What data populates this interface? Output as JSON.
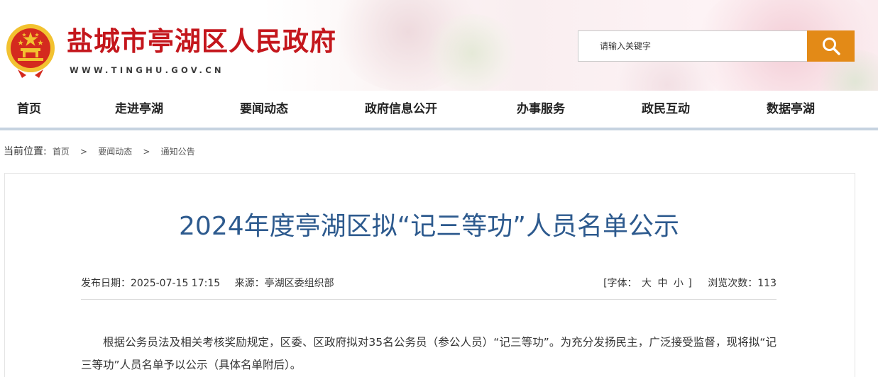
{
  "header": {
    "site_title": "盐城市亭湖区人民政府",
    "site_domain": "WWW.TINGHU.GOV.CN",
    "emblem_icon": "national-emblem-icon",
    "colors": {
      "title_red": "#c4161c",
      "search_orange": "#e38a17",
      "emblem_red": "#d42a1e",
      "emblem_gold": "#f2c230"
    }
  },
  "search": {
    "placeholder": "请输入关键字",
    "button_icon": "search-icon"
  },
  "nav": {
    "items": [
      {
        "label": "首页"
      },
      {
        "label": "走进亭湖"
      },
      {
        "label": "要闻动态"
      },
      {
        "label": "政府信息公开"
      },
      {
        "label": "办事服务"
      },
      {
        "label": "政民互动"
      },
      {
        "label": "数据亭湖"
      }
    ]
  },
  "breadcrumb": {
    "label": "当前位置:",
    "items": [
      "首页",
      "要闻动态",
      "通知公告"
    ],
    "separator": ">"
  },
  "article": {
    "title": "2024年度亭湖区拟“记三等功”人员名单公示",
    "publish_label": "发布日期：",
    "publish_date": "2025-07-15 17:15",
    "source_label": "来源：",
    "source": "亭湖区委组织部",
    "font_size_prefix": "[字体：",
    "font_size_options": [
      "大",
      "中",
      "小"
    ],
    "font_size_suffix": "]",
    "views_label": "浏览次数：",
    "views": "113",
    "body": "根据公务员法及相关考核奖励规定，区委、区政府拟对35名公务员（参公人员）“记三等功”。为充分发扬民主，广泛接受监督，现将拟“记三等功”人员名单予以公示（具体名单附后）。"
  }
}
